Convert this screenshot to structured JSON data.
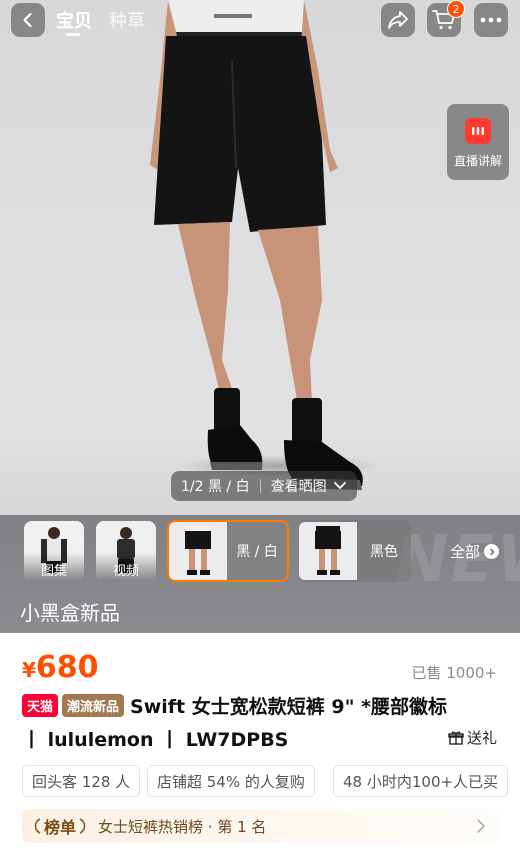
{
  "top_bar": {
    "tabs": [
      {
        "label": "宝贝",
        "active": true
      },
      {
        "label": "种草",
        "active": false
      }
    ],
    "cart_count": "2",
    "icons": [
      "back-icon",
      "share-icon",
      "cart-icon",
      "more-icon"
    ]
  },
  "live": {
    "label": "直播讲解",
    "icon": "live-icon"
  },
  "gallery": {
    "counter": "1/2 黑 / 白",
    "review_label": "查看晒图"
  },
  "thumbs": [
    {
      "label": "图集"
    },
    {
      "label": "视频"
    }
  ],
  "variants": [
    {
      "label": "黑 / 白",
      "selected": true
    },
    {
      "label": "黑色",
      "selected": false
    }
  ],
  "all_label": "全部",
  "promo_text": "小黑盒新品",
  "price": {
    "currency": "¥",
    "amount": "680"
  },
  "sold": "已售 1000+",
  "title": {
    "tag_tmall": "天猫",
    "tag_new": "潮流新品",
    "line1": "Swift 女士宽松款短裤 9\" *腰部徽标",
    "line2": "丨 lululemon 丨 LW7DPBS"
  },
  "gift_label": "送礼",
  "chips": [
    "回头客 128 人",
    "店铺超 54% 的人复购",
    "48 小时内100+人已买"
  ],
  "rank": {
    "badge": "榜单",
    "text": "女士短裤热销榜 · 第 1 名"
  },
  "colors": {
    "accent": "#ff5000",
    "tmall": "#ff0036",
    "new_tag": "#a27a52",
    "live": "#ff3b30"
  }
}
